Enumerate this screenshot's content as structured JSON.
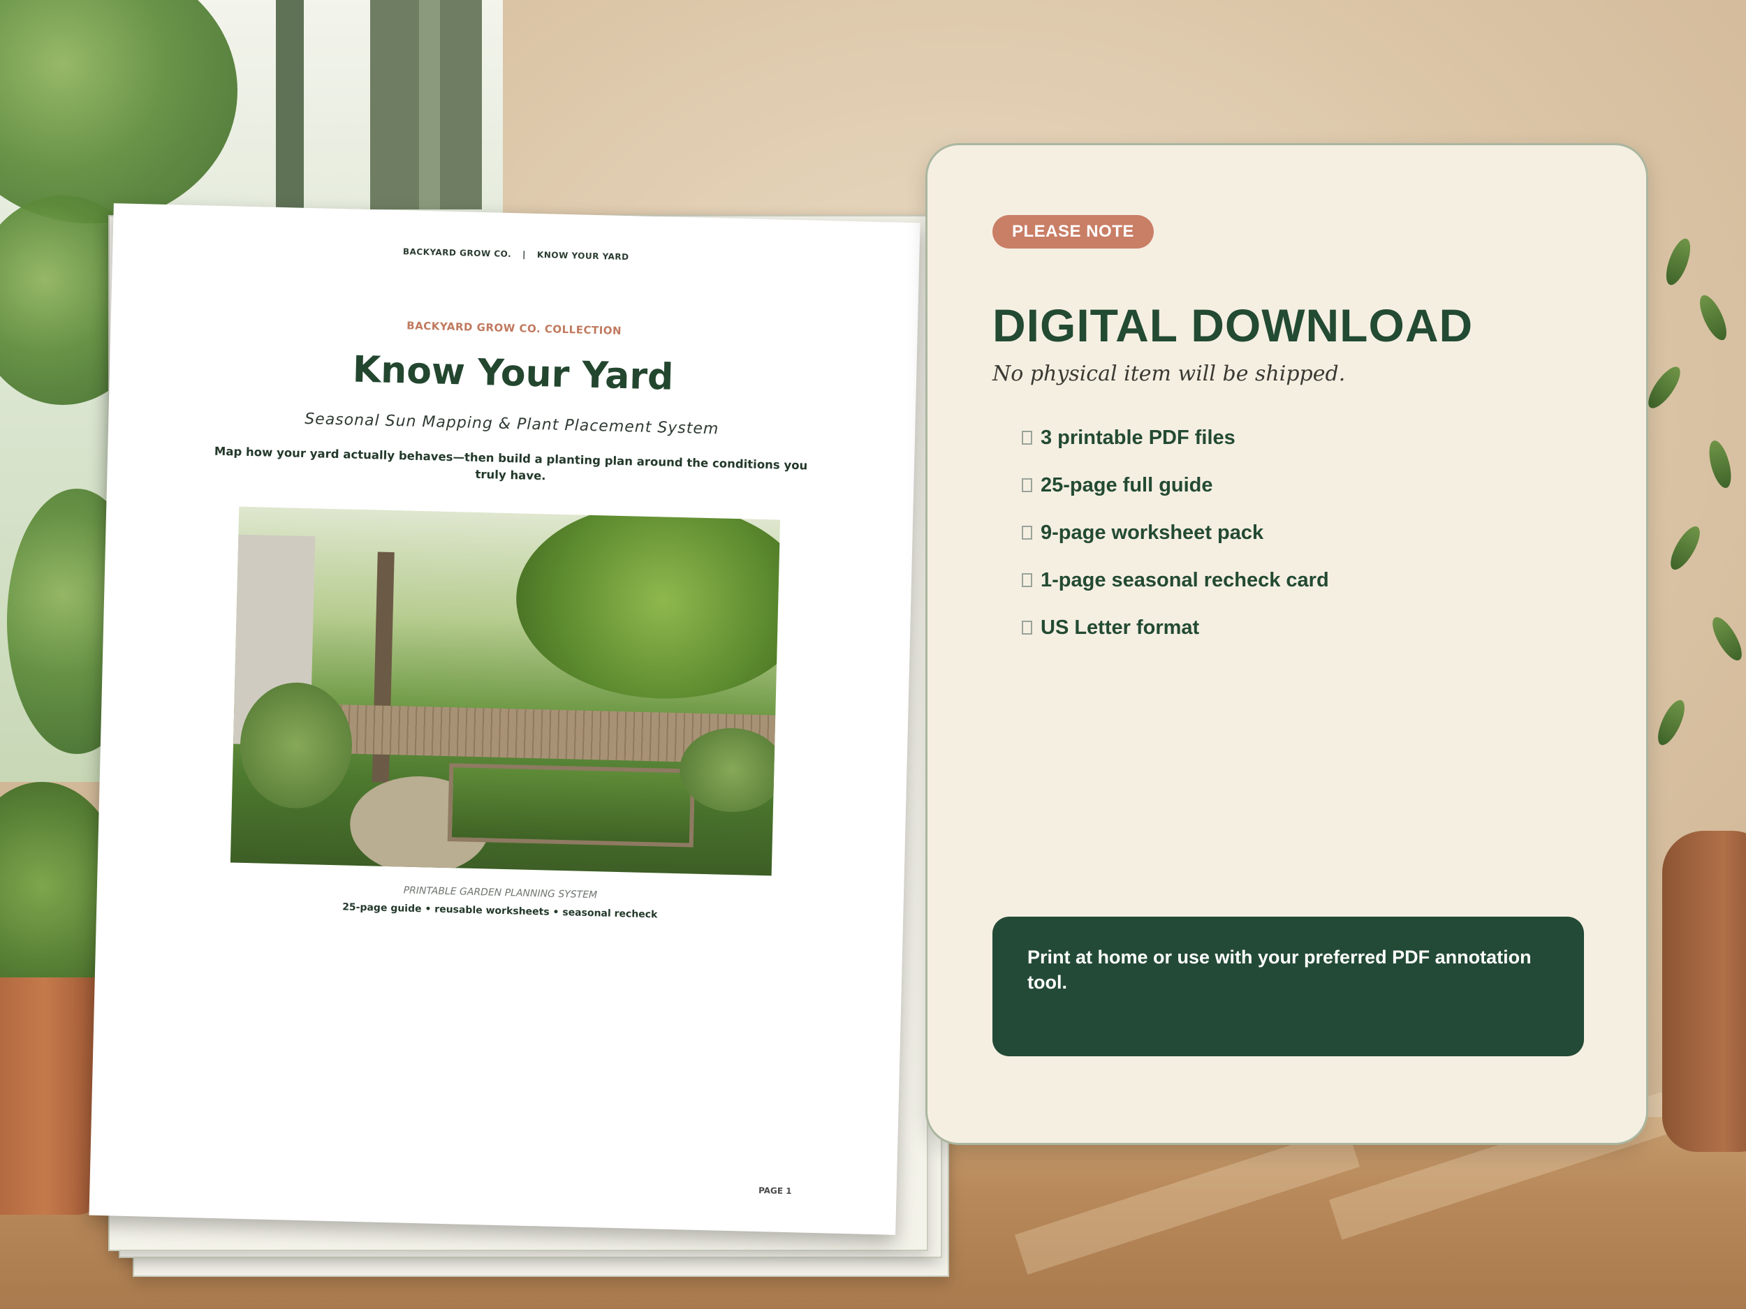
{
  "document": {
    "header_brand": "BACKYARD GROW CO.",
    "header_separator": "|",
    "header_product": "KNOW YOUR YARD",
    "collection": "BACKYARD GROW CO. COLLECTION",
    "title": "Know Your Yard",
    "subtitle": "Seasonal Sun Mapping & Plant Placement System",
    "description": "Map how your yard actually behaves—then build a planting plan around the conditions you truly have.",
    "caption_primary": "PRINTABLE GARDEN PLANNING SYSTEM",
    "caption_secondary": "25-page guide • reusable worksheets • seasonal recheck",
    "page_number": "PAGE 1"
  },
  "panel": {
    "badge": "PLEASE NOTE",
    "title": "DIGITAL DOWNLOAD",
    "subtitle": "No physical item will be shipped.",
    "features": [
      "3 printable PDF files",
      "25-page full guide",
      "9-page worksheet pack",
      "1-page seasonal recheck card",
      "US Letter format"
    ],
    "note": "Print at home or use with your preferred PDF annotation tool."
  },
  "colors": {
    "accent_green": "#234a33",
    "badge_terracotta": "#c97e66",
    "panel_cream": "#f5efe2"
  }
}
